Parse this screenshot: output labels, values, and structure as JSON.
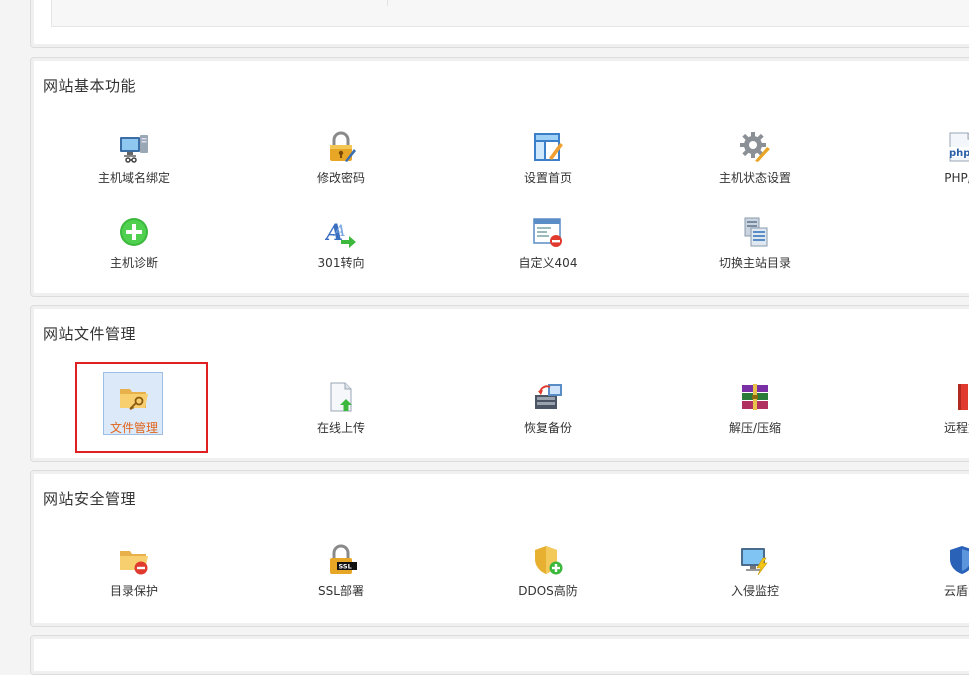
{
  "sections": {
    "basic": {
      "title": "网站基本功能",
      "items": [
        {
          "label": "主机域名绑定",
          "icon": "monitor-network-icon"
        },
        {
          "label": "修改密码",
          "icon": "padlock-pencil-icon"
        },
        {
          "label": "设置首页",
          "icon": "layout-pencil-icon"
        },
        {
          "label": "主机状态设置",
          "icon": "gear-pencil-icon"
        },
        {
          "label": "PHP版",
          "icon": "php-file-icon"
        },
        {
          "label": "主机诊断",
          "icon": "green-plus-icon"
        },
        {
          "label": "301转向",
          "icon": "font-arrow-icon"
        },
        {
          "label": "自定义404",
          "icon": "window-error-icon"
        },
        {
          "label": "切换主站目录",
          "icon": "server-stack-icon"
        }
      ]
    },
    "files": {
      "title": "网站文件管理",
      "items": [
        {
          "label": "文件管理",
          "icon": "folder-key-icon",
          "selected": true
        },
        {
          "label": "在线上传",
          "icon": "file-upload-icon"
        },
        {
          "label": "恢复备份",
          "icon": "backup-restore-icon"
        },
        {
          "label": "解压/压缩",
          "icon": "archive-books-icon"
        },
        {
          "label": "远程文",
          "icon": "remote-file-icon"
        }
      ]
    },
    "security": {
      "title": "网站安全管理",
      "items": [
        {
          "label": "目录保护",
          "icon": "folder-minus-icon"
        },
        {
          "label": "SSL部署",
          "icon": "ssl-lock-icon"
        },
        {
          "label": "DDOS高防",
          "icon": "shield-plus-icon"
        },
        {
          "label": "入侵监控",
          "icon": "monitor-lightning-icon"
        },
        {
          "label": "云盾防",
          "icon": "blue-shield-icon"
        }
      ]
    }
  },
  "ssl_badge_text": "SSL",
  "php_badge_text": "php",
  "colors": {
    "highlight_border": "#e02020",
    "selected_label": "#e0641b",
    "selected_bg": "#dce9f8"
  }
}
